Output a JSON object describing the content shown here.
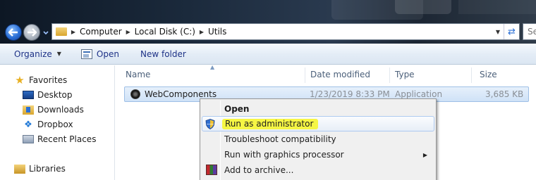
{
  "address_bar": {
    "breadcrumbs": [
      "Computer",
      "Local Disk (C:)",
      "Utils"
    ],
    "search_placeholder": "Se"
  },
  "command_bar": {
    "organize_label": "Organize",
    "open_label": "Open",
    "new_folder_label": "New folder"
  },
  "nav_pane": {
    "favorites_label": "Favorites",
    "items": [
      "Desktop",
      "Downloads",
      "Dropbox",
      "Recent Places"
    ],
    "libraries_label": "Libraries"
  },
  "file_list": {
    "columns": [
      "Name",
      "Date modified",
      "Type",
      "Size"
    ],
    "rows": [
      {
        "name": "WebComponents",
        "date_modified": "1/23/2019 8:33 PM",
        "type": "Application",
        "size": "3,685 KB"
      }
    ]
  },
  "context_menu": {
    "items": [
      "Open",
      "Run as administrator",
      "Troubleshoot compatibility",
      "Run with graphics processor",
      "Add to archive..."
    ]
  },
  "colors": {
    "highlight_marker": "#f5f53a",
    "selection_blue": "#cfe2f7",
    "link_text": "#1e3287"
  }
}
